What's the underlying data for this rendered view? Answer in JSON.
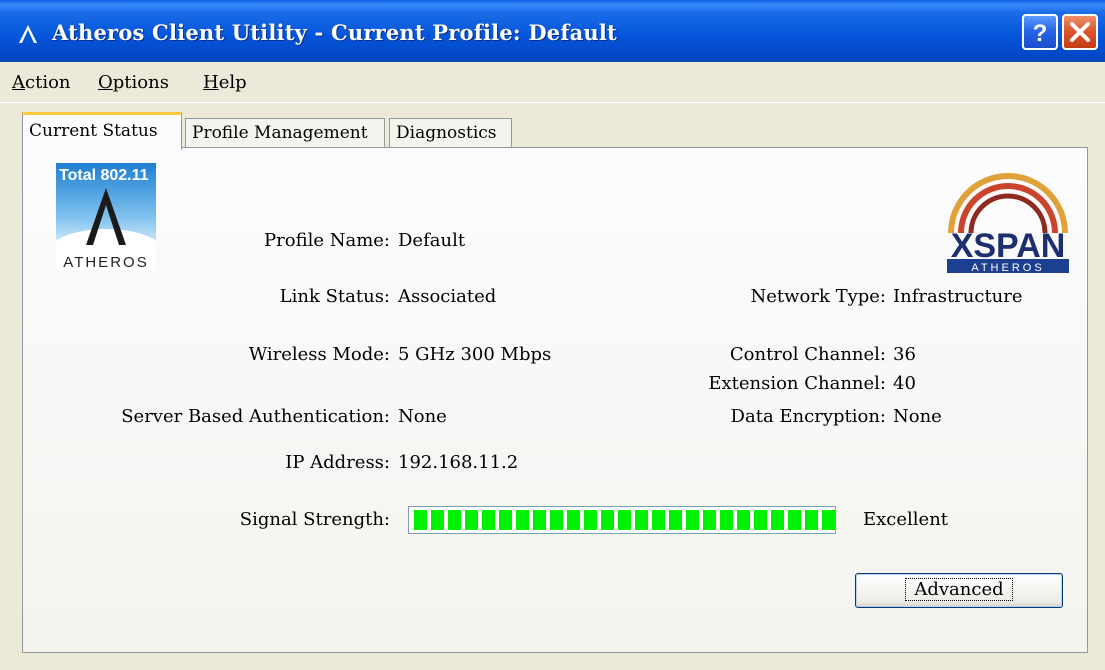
{
  "window": {
    "title": "Atheros Client Utility - Current Profile: Default",
    "help_glyph": "?",
    "close_glyph": "✕"
  },
  "menu": [
    {
      "label": "Action"
    },
    {
      "label": "Options"
    },
    {
      "label": "Help"
    }
  ],
  "tabs": [
    {
      "label": "Current Status",
      "active": true
    },
    {
      "label": "Profile Management",
      "active": false
    },
    {
      "label": "Diagnostics",
      "active": false
    }
  ],
  "logos": {
    "left_text_top": "Total 802.11",
    "left_text_bottom": "ATHEROS",
    "right_text_top": "XSPAN",
    "right_text_bottom": "ATHEROS"
  },
  "status": {
    "profile_name_label": "Profile Name:",
    "profile_name": "Default",
    "link_status_label": "Link Status:",
    "link_status": "Associated",
    "wireless_mode_label": "Wireless Mode:",
    "wireless_mode": "5 GHz 300 Mbps",
    "server_auth_label": "Server Based Authentication:",
    "server_auth": "None",
    "ip_label": "IP Address:",
    "ip": "192.168.11.2",
    "network_type_label": "Network Type:",
    "network_type": "Infrastructure",
    "control_channel_label": "Control Channel:",
    "control_channel": "36",
    "extension_channel_label": "Extension Channel:",
    "extension_channel": "40",
    "data_encryption_label": "Data Encryption:",
    "data_encryption": "None",
    "signal_label": "Signal Strength:",
    "signal_text": "Excellent",
    "signal_level": 1.0
  },
  "buttons": {
    "advanced": "Advanced"
  },
  "colors": {
    "titlebar": "#0453d9",
    "signal_bar": "#00f000",
    "active_tab_accent": "#ffc83c"
  }
}
